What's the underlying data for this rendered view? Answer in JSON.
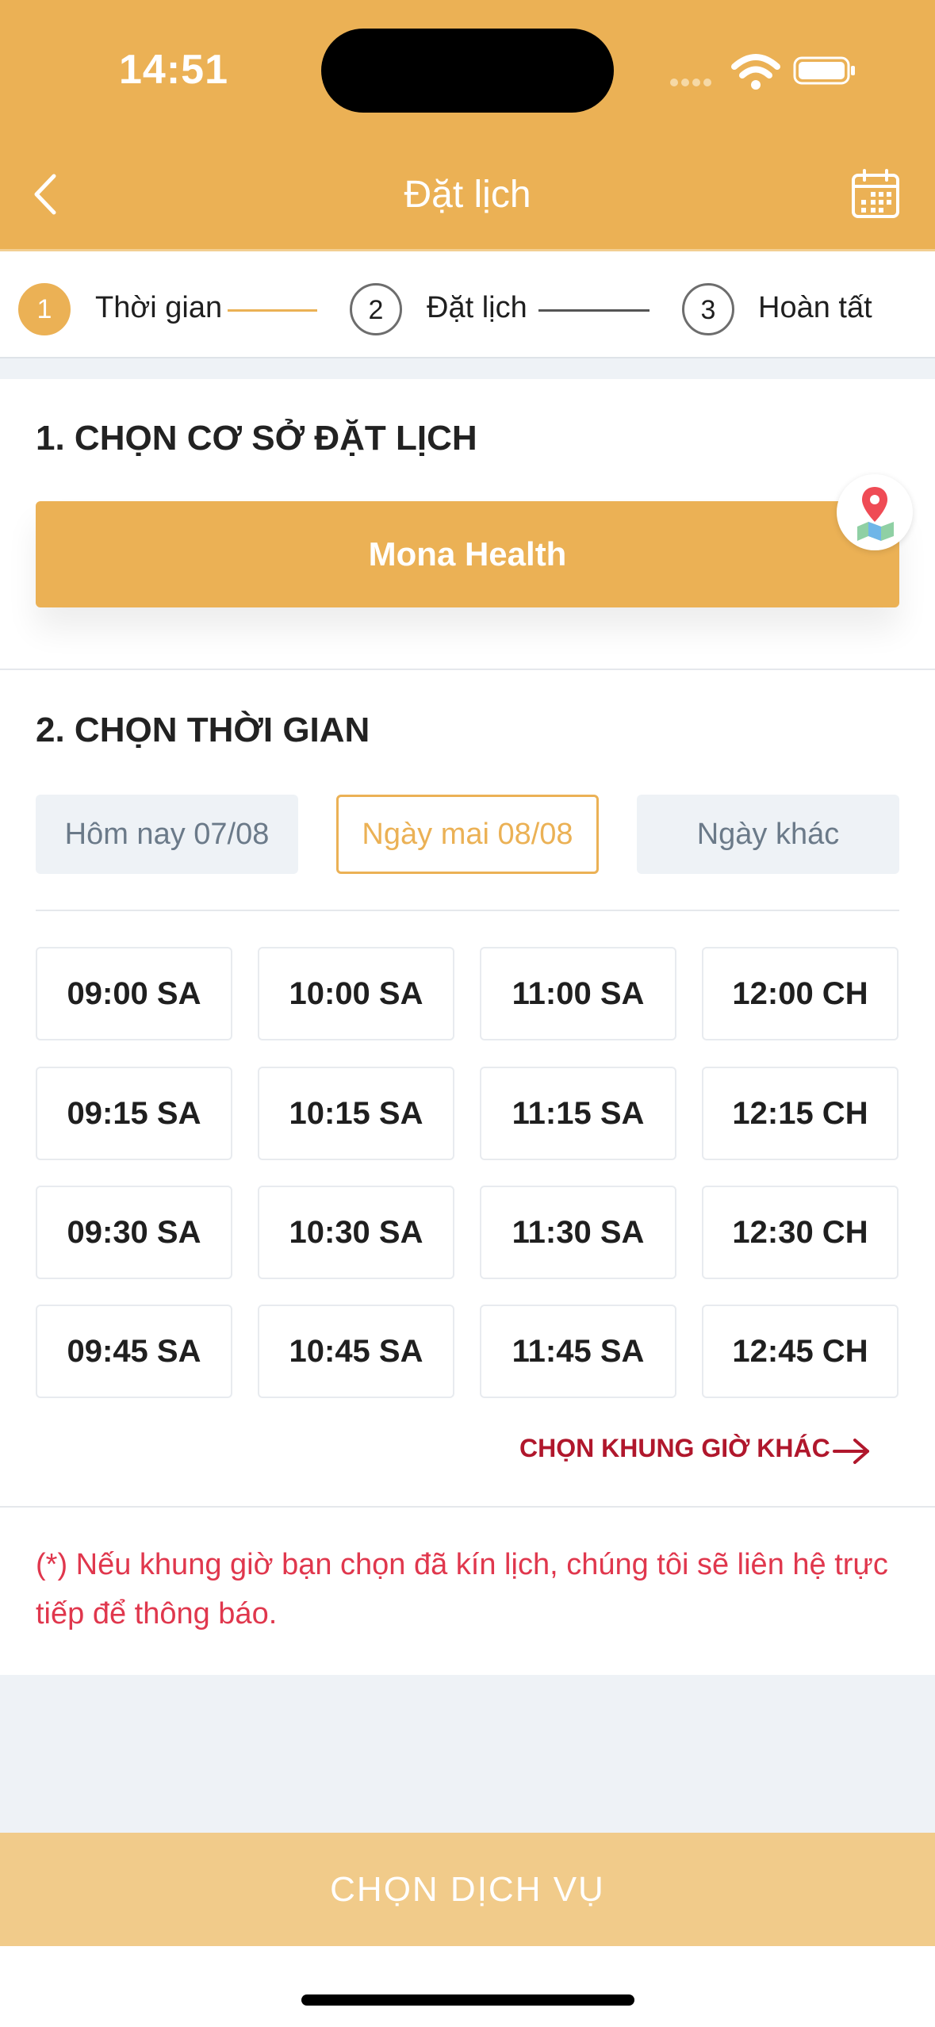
{
  "status_bar": {
    "time": "14:51"
  },
  "header": {
    "title": "Đặt lịch",
    "accent_color": "#EBB155",
    "back_icon": "chevron-left-icon",
    "calendar_icon": "calendar-icon"
  },
  "stepper": {
    "steps": [
      {
        "number": "1",
        "label": "Thời gian",
        "active": true
      },
      {
        "number": "2",
        "label": "Đặt lịch",
        "active": false
      },
      {
        "number": "3",
        "label": "Hoàn tất",
        "active": false
      }
    ]
  },
  "branch_section": {
    "title": "1. CHỌN CƠ SỞ ĐẶT LỊCH",
    "branch_name": "Mona Health",
    "map_icon": "map-pin-icon"
  },
  "time_section": {
    "title": "2. CHỌN THỜI GIAN",
    "dates": [
      {
        "label": "Hôm nay 07/08",
        "selected": false
      },
      {
        "label": "Ngày mai 08/08",
        "selected": true
      },
      {
        "label": "Ngày khác",
        "selected": false
      }
    ],
    "slots": [
      [
        "09:00 SA",
        "10:00 SA",
        "11:00 SA",
        "12:00 CH"
      ],
      [
        "09:15 SA",
        "10:15 SA",
        "11:15 SA",
        "12:15 CH"
      ],
      [
        "09:30 SA",
        "10:30 SA",
        "11:30 SA",
        "12:30 CH"
      ],
      [
        "09:45 SA",
        "10:45 SA",
        "11:45 SA",
        "12:45 CH"
      ]
    ],
    "other_time_label": "CHỌN KHUNG GIỜ KHÁC",
    "note": "(*) Nếu khung giờ bạn chọn đã kín lịch, chúng tôi sẽ liên hệ trực tiếp để thông báo."
  },
  "footer": {
    "cta_label": "CHỌN DỊCH VỤ"
  }
}
